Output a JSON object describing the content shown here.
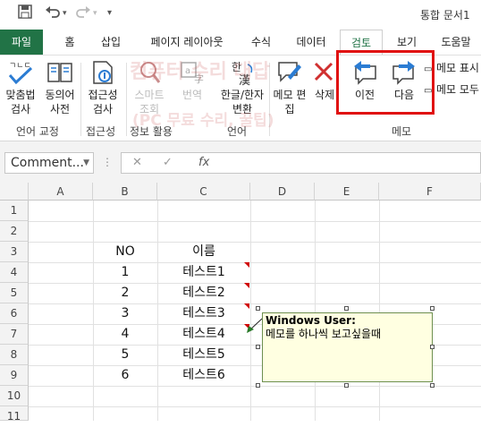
{
  "title_bar": {
    "document_title": "통합 문서1"
  },
  "tabs": [
    "파일",
    "홈",
    "삽입",
    "페이지 레이아웃",
    "수식",
    "데이터",
    "검토",
    "보기",
    "도움말"
  ],
  "active_tab": "검토",
  "ribbon": {
    "spelling": "맞춤법 검사",
    "thesaurus": "동의어 사전",
    "accessibility": "접근성 검사",
    "smart_lookup": "스마트 조회",
    "translate": "번역",
    "hangul_hanja": "한글/한자 변환",
    "edit_comment": "메모 편집",
    "delete": "삭제",
    "previous": "이전",
    "next": "다음",
    "show_comment": "메모 표시",
    "show_all_comments": "메모 모두",
    "groups": {
      "proofing": "언어 교정",
      "accessibility": "접근성",
      "insights": "정보 활용",
      "language": "언어",
      "comments": "메모"
    }
  },
  "watermark": {
    "line1": "컴퓨터 수리 대답",
    "line2": "(PC 무료 수리, 꿀팁)"
  },
  "formula_bar": {
    "name_box": "Comment...",
    "cancel": "✕",
    "enter": "✓",
    "fx": "fx",
    "value": ""
  },
  "columns": [
    "A",
    "B",
    "C",
    "D",
    "E",
    "F"
  ],
  "rows": [
    "1",
    "2",
    "3",
    "4",
    "5",
    "6",
    "7",
    "8",
    "9",
    "10",
    "11"
  ],
  "table": {
    "header": {
      "no": "NO",
      "name": "이름"
    },
    "data": [
      {
        "no": "1",
        "name": "테스트1"
      },
      {
        "no": "2",
        "name": "테스트2"
      },
      {
        "no": "3",
        "name": "테스트3"
      },
      {
        "no": "4",
        "name": "테스트4"
      },
      {
        "no": "5",
        "name": "테스트5"
      },
      {
        "no": "6",
        "name": "테스트6"
      }
    ]
  },
  "comment": {
    "author": "Windows User:",
    "text": "메모를 하나씩 보고싶을때"
  },
  "colors": {
    "excel_green": "#217346",
    "highlight_red": "#e01010",
    "comment_bg": "#ffffe1",
    "indicator_red": "#d00000"
  }
}
